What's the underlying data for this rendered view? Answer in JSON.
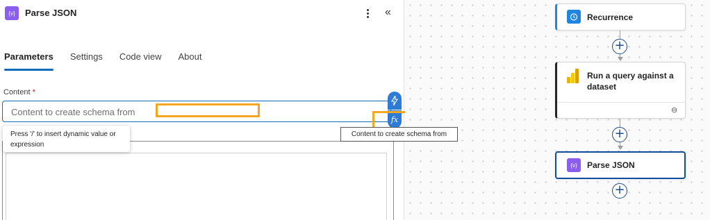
{
  "panel": {
    "title": "Parse JSON",
    "icon": "parse-json-icon",
    "tabs": [
      {
        "label": "Parameters",
        "active": true
      },
      {
        "label": "Settings",
        "active": false
      },
      {
        "label": "Code view",
        "active": false
      },
      {
        "label": "About",
        "active": false
      }
    ],
    "content_field": {
      "label": "Content",
      "required_mark": "*",
      "placeholder": "Content to create schema from"
    },
    "hint": "Press '/' to insert dynamic value or expression",
    "tooltip": "Content to create schema from",
    "fx_label": "fx"
  },
  "flow": {
    "nodes": [
      {
        "title": "Recurrence",
        "icon": "clock-icon",
        "accent": "#1f85e0"
      },
      {
        "title": "Run a query against a dataset",
        "icon": "power-bi-icon",
        "accent": "#242424"
      },
      {
        "title": "Parse JSON",
        "icon": "parse-json-icon",
        "accent": "#8b5ef0",
        "selected": true
      }
    ]
  },
  "colors": {
    "highlight": "#f5a623",
    "primary": "#0f6cbd"
  }
}
